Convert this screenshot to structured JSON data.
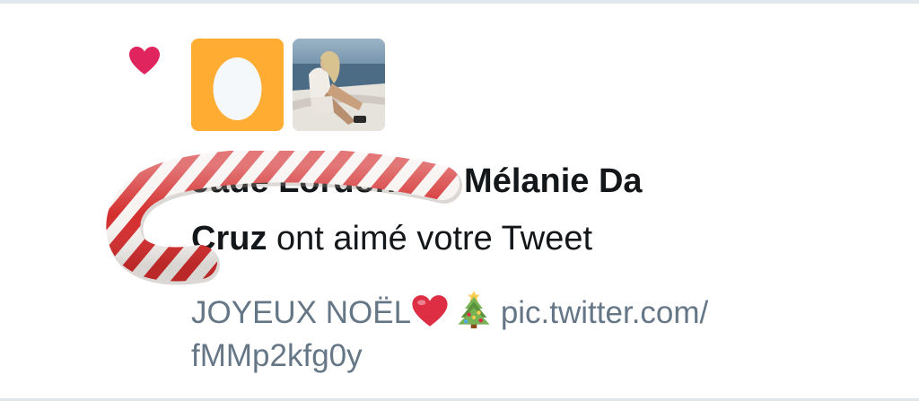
{
  "notification": {
    "type_icon": "heart-icon",
    "type_icon_color": "#e0245e",
    "avatars": [
      {
        "name": "default-egg-avatar",
        "bg_color": "#ffac33"
      },
      {
        "name": "user-photo-avatar"
      }
    ],
    "user1_name": "Jade Lordonu",
    "connector": " et ",
    "user2_name_part1": "Mélanie Da",
    "user2_name_part2": "Cruz",
    "action_text": " ont aimé votre Tweet"
  },
  "tweet": {
    "text": "JOYEUX NOËL",
    "emojis": [
      "red-heart-icon",
      "christmas-tree-icon"
    ],
    "link_part1": "pic.twitter.com/",
    "link_part2": "fMMp2kfg0y"
  },
  "overlay": {
    "sticker": "candy-cane-sticker"
  },
  "colors": {
    "text_primary": "#14171a",
    "text_secondary": "#657786",
    "divider": "#e1e8ed"
  }
}
